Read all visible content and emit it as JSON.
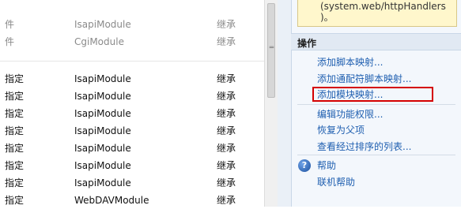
{
  "handler_rows": [
    {
      "path": "件",
      "handler": "IsapiModule",
      "entry": "继承",
      "dim": true
    },
    {
      "path": "件",
      "handler": "CgiModule",
      "entry": "继承",
      "dim": true
    },
    {
      "path": "指定",
      "handler": "IsapiModule",
      "entry": "继承",
      "dim": false
    },
    {
      "path": "指定",
      "handler": "IsapiModule",
      "entry": "继承",
      "dim": false
    },
    {
      "path": "指定",
      "handler": "IsapiModule",
      "entry": "继承",
      "dim": false
    },
    {
      "path": "指定",
      "handler": "IsapiModule",
      "entry": "继承",
      "dim": false
    },
    {
      "path": "指定",
      "handler": "IsapiModule",
      "entry": "继承",
      "dim": false
    },
    {
      "path": "指定",
      "handler": "IsapiModule",
      "entry": "继承",
      "dim": false
    },
    {
      "path": "指定",
      "handler": "IsapiModule",
      "entry": "继承",
      "dim": false
    },
    {
      "path": "指定",
      "handler": "WebDAVModule",
      "entry": "继承",
      "dim": false
    }
  ],
  "info_box": {
    "line1": "(system.web/httpHandlers",
    "line2": ")。"
  },
  "actions": {
    "header": "操作",
    "add_script_map": "添加脚本映射...",
    "add_wildcard_script_map": "添加通配符脚本映射...",
    "add_module_map": "添加模块映射...",
    "edit_feature_permissions": "编辑功能权限...",
    "revert_to_parent": "恢复为父项",
    "view_ordered_list": "查看经过排序的列表...",
    "help": "帮助",
    "online_help": "联机帮助"
  },
  "colors": {
    "link": "#1f5fb0",
    "highlight_border": "#d40000",
    "info_background": "#fff7cc"
  }
}
